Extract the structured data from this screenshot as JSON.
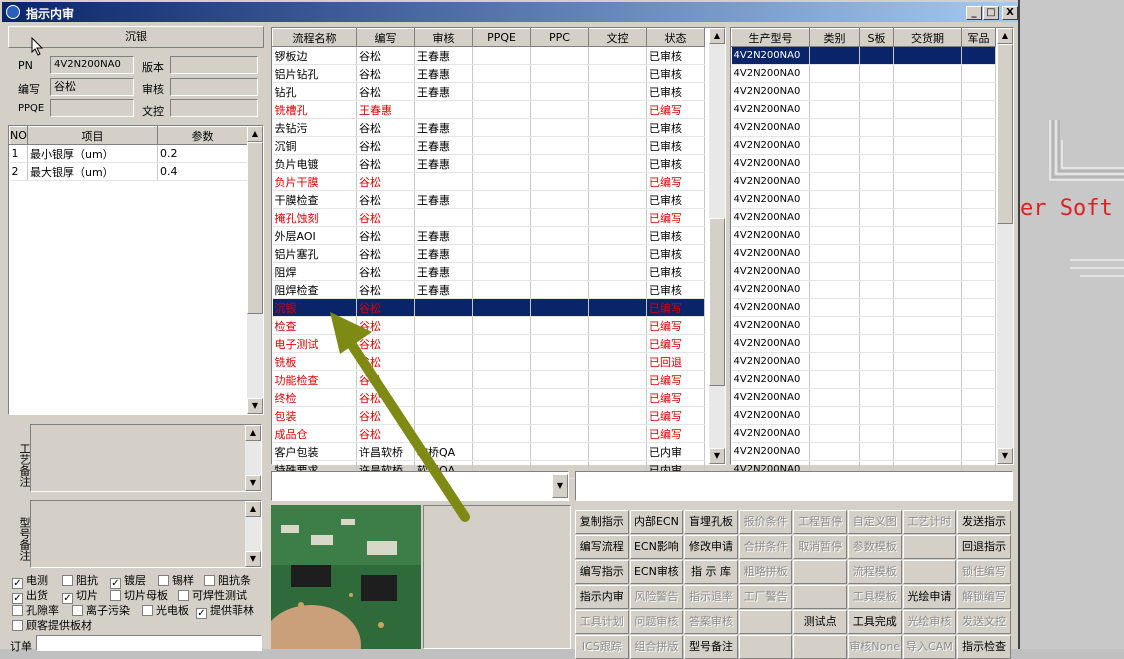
{
  "window": {
    "title": "指示内审",
    "min": "_",
    "max": "□",
    "close": "X"
  },
  "background_app": {
    "text": "er Soft"
  },
  "left": {
    "section_title": "沉银",
    "pn_label": "PN",
    "pn_value": "4V2N200NA0",
    "version_label": "版本",
    "version_value": "",
    "author_label": "编写",
    "author_value": "谷松",
    "review_label": "审核",
    "review_value": "",
    "ppqe_label": "PPQE",
    "ppqe_value": "",
    "dc_label": "文控",
    "dc_value": "",
    "param_headers": [
      "NO",
      "项目",
      "参数"
    ],
    "params": [
      {
        "no": "1",
        "item": "最小银厚（um）",
        "value": "0.2"
      },
      {
        "no": "2",
        "item": "最大银厚（um）",
        "value": "0.4"
      }
    ],
    "process_note_label": "工艺备注",
    "model_note_label": "型号备注",
    "checkboxes": [
      {
        "label": "电测",
        "checked": true
      },
      {
        "label": "阻抗",
        "checked": false
      },
      {
        "label": "镀层",
        "checked": true
      },
      {
        "label": "锡样",
        "checked": false
      },
      {
        "label": "阻抗条",
        "checked": false
      },
      {
        "label": "出货",
        "checked": true
      },
      {
        "label": "切片",
        "checked": true
      },
      {
        "label": "切片母板",
        "checked": false
      },
      {
        "label": "可焊性测试",
        "checked": false
      },
      {
        "label": "孔隙率",
        "checked": false
      },
      {
        "label": "离子污染",
        "checked": false
      },
      {
        "label": "光电板",
        "checked": false
      },
      {
        "label": "提供菲林",
        "checked": true
      },
      {
        "label": "顾客提供板材",
        "checked": false
      }
    ],
    "order_label": "订单"
  },
  "process": {
    "headers": [
      "流程名称",
      "编写",
      "审核",
      "PPQE",
      "PPC",
      "文控",
      "状态"
    ],
    "rows": [
      {
        "name": "锣板边",
        "author": "谷松",
        "reviewer": "王春惠",
        "status": "已审核",
        "style": "normal"
      },
      {
        "name": "铝片钻孔",
        "author": "谷松",
        "reviewer": "王春惠",
        "status": "已审核",
        "style": "normal"
      },
      {
        "name": "钻孔",
        "author": "谷松",
        "reviewer": "王春惠",
        "status": "已审核",
        "style": "normal"
      },
      {
        "name": "铣槽孔",
        "author": "王春惠",
        "reviewer": "",
        "status": "已编写",
        "style": "red"
      },
      {
        "name": "去钻污",
        "author": "谷松",
        "reviewer": "王春惠",
        "status": "已审核",
        "style": "normal"
      },
      {
        "name": "沉铜",
        "author": "谷松",
        "reviewer": "王春惠",
        "status": "已审核",
        "style": "normal"
      },
      {
        "name": "负片电镀",
        "author": "谷松",
        "reviewer": "王春惠",
        "status": "已审核",
        "style": "normal"
      },
      {
        "name": "负片干膜",
        "author": "谷松",
        "reviewer": "",
        "status": "已编写",
        "style": "red"
      },
      {
        "name": "干膜检查",
        "author": "谷松",
        "reviewer": "王春惠",
        "status": "已审核",
        "style": "normal"
      },
      {
        "name": "掩孔蚀刻",
        "author": "谷松",
        "reviewer": "",
        "status": "已编写",
        "style": "red"
      },
      {
        "name": "外层AOI",
        "author": "谷松",
        "reviewer": "王春惠",
        "status": "已审核",
        "style": "normal"
      },
      {
        "name": "铝片塞孔",
        "author": "谷松",
        "reviewer": "王春惠",
        "status": "已审核",
        "style": "normal"
      },
      {
        "name": "阻焊",
        "author": "谷松",
        "reviewer": "王春惠",
        "status": "已审核",
        "style": "normal"
      },
      {
        "name": "阻焊检查",
        "author": "谷松",
        "reviewer": "王春惠",
        "status": "已审核",
        "style": "normal"
      },
      {
        "name": "沉银",
        "author": "谷松",
        "reviewer": "",
        "status": "已编写",
        "style": "selected"
      },
      {
        "name": "检查",
        "author": "谷松",
        "reviewer": "",
        "status": "已编写",
        "style": "red"
      },
      {
        "name": "电子测试",
        "author": "谷松",
        "reviewer": "",
        "status": "已编写",
        "style": "red"
      },
      {
        "name": "铣板",
        "author": "谷松",
        "reviewer": "",
        "status": "已回退",
        "style": "red"
      },
      {
        "name": "功能检查",
        "author": "谷松",
        "reviewer": "",
        "status": "已编写",
        "style": "red"
      },
      {
        "name": "终检",
        "author": "谷松",
        "reviewer": "",
        "status": "已编写",
        "style": "red"
      },
      {
        "name": "包装",
        "author": "谷松",
        "reviewer": "",
        "status": "已编写",
        "style": "red"
      },
      {
        "name": "成品仓",
        "author": "谷松",
        "reviewer": "",
        "status": "已编写",
        "style": "red"
      },
      {
        "name": "客户包装",
        "author": "许昌软桥",
        "reviewer": "软桥QA",
        "status": "已内审",
        "style": "normal"
      },
      {
        "name": "特殊要求",
        "author": "许昌软桥",
        "reviewer": "软桥QA",
        "status": "已内审",
        "style": "normal"
      }
    ]
  },
  "model_table": {
    "headers": [
      "生产型号",
      "类别",
      "S板",
      "交货期",
      "军品"
    ],
    "model": "4V2N200NA0",
    "row_count": 24
  },
  "buttons": [
    [
      "复制指示",
      "内部ECN",
      "盲埋孔板",
      "报价条件",
      "工程暂停",
      "自定义图",
      "工艺计时",
      "发送指示"
    ],
    [
      "编写流程",
      "ECN影响",
      "修改申请",
      "合拼条件",
      "取消暂停",
      "参数模板",
      "",
      "回退指示"
    ],
    [
      "编写指示",
      "ECN审核",
      "指 示 库",
      "粗略拼板",
      "",
      "流程模板",
      "",
      "锁住编写"
    ],
    [
      "指示内审",
      "风险警告",
      "指示退率",
      "工厂警告",
      "",
      "工具模板",
      "光绘申请",
      "解锁编写"
    ],
    [
      "工具计划",
      "问题审核",
      "答案审核",
      "",
      "测试点",
      "工具完成",
      "光绘审核",
      "发送文控"
    ],
    [
      "ICS跟踪",
      "组合拼版",
      "型号备注",
      "",
      "",
      "审核None",
      "导入CAM",
      "指示检查"
    ]
  ],
  "disabled_buttons": [
    "报价条件",
    "工程暂停",
    "自定义图",
    "工艺计时",
    "合拼条件",
    "取消暂停",
    "参数模板",
    "粗略拼板",
    "流程模板",
    "锁住编写",
    "风险警告",
    "指示退率",
    "工厂警告",
    "工具模板",
    "解锁编写",
    "工具计划",
    "问题审核",
    "答案审核",
    "光绘审核",
    "发送文控",
    "ICS跟踪",
    "组合拼版",
    "审核None",
    "导入CAM"
  ]
}
